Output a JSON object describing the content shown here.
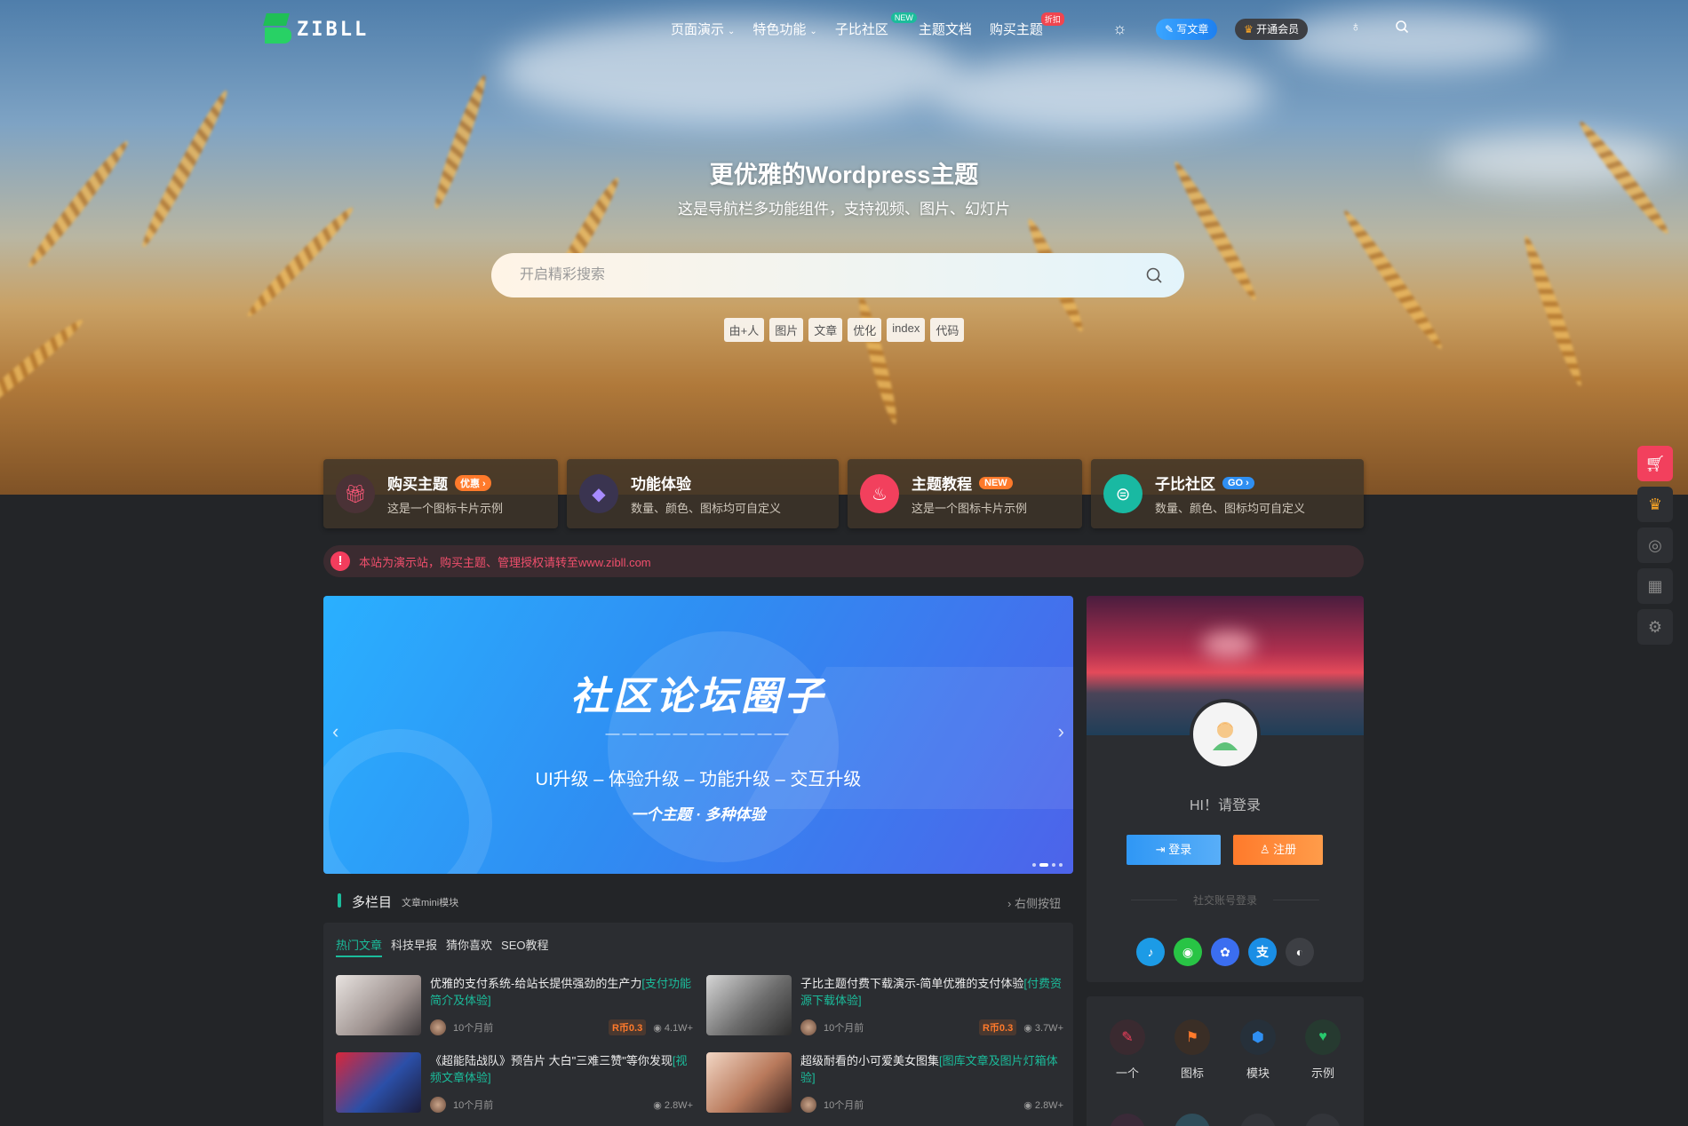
{
  "nav": {
    "logo_text": "ZIBLL",
    "menu": [
      {
        "label": "页面演示",
        "dropdown": true
      },
      {
        "label": "特色功能",
        "dropdown": true
      },
      {
        "label": "子比社区",
        "badge": "NEW"
      },
      {
        "label": "主题文档"
      },
      {
        "label": "购买主题",
        "badge": "折扣"
      }
    ],
    "write_label": "写文章",
    "vip_label": "开通会员"
  },
  "hero": {
    "title": "更优雅的Wordpress主题",
    "subtitle": "这是导航栏多功能组件，支持视频、图片、幻灯片",
    "search_placeholder": "开启精彩搜索",
    "tags": [
      "由+人",
      "图片",
      "文章",
      "优化",
      "index",
      "代码"
    ]
  },
  "cards": [
    {
      "title": "购买主题",
      "pill": "优惠 ›",
      "desc": "这是一个图标卡片示例",
      "color": "#e94560",
      "pill_color": "#ff7a2b"
    },
    {
      "title": "功能体验",
      "pill": "",
      "desc": "数量、颜色、图标均可自定义",
      "color": "#7b5cf0",
      "pill_color": ""
    },
    {
      "title": "主题教程",
      "pill": "NEW",
      "desc": "这是一个图标卡片示例",
      "color": "#f2405d",
      "pill_color": "#ff7a2b"
    },
    {
      "title": "子比社区",
      "pill": "GO ›",
      "desc": "数量、颜色、图标均可自定义",
      "color": "#19b9a2",
      "pill_color": "#2f8ff2"
    }
  ],
  "notice": "本站为演示站，购买主题、管理授权请转至www.zibll.com",
  "slider": {
    "title": "社区论坛圈子",
    "dashes": "———————————",
    "subtitle": "UI升级 – 体验升级 – 功能升级 – 交互升级",
    "tagline": "一个主题 · 多种体验"
  },
  "section": {
    "title": "多栏目",
    "subtitle": "文章mini模块",
    "right": "› 右侧按钮"
  },
  "tabs": [
    "热门文章",
    "科技早报",
    "猜你喜欢",
    "SEO教程"
  ],
  "articles": [
    {
      "title": "优雅的支付系统-给站长提供强劲的生产力",
      "tag": "[支付功能简介及体验]",
      "time": "10个月前",
      "price": "R币0.3",
      "views": "4.1W+"
    },
    {
      "title": "子比主题付费下载演示-简单优雅的支付体验",
      "tag": "[付费资源下载体验]",
      "time": "10个月前",
      "price": "R币0.3",
      "views": "3.7W+"
    },
    {
      "title": "《超能陆战队》预告片 大白\"三难三赞\"等你发现",
      "tag": "[视频文章体验]",
      "time": "10个月前",
      "price": "",
      "views": "2.8W+"
    },
    {
      "title": "超级耐看的小可爱美女图集",
      "tag": "[图库文章及图片灯箱体验]",
      "time": "10个月前",
      "price": "",
      "views": "2.8W+"
    }
  ],
  "user": {
    "greeting": "HI！请登录",
    "login": "登录",
    "register": "注册",
    "social_label": "社交账号登录"
  },
  "icon_grid": [
    {
      "label": "一个",
      "bg": "#3a2a30",
      "fg": "#f2405d"
    },
    {
      "label": "图标",
      "bg": "#3a2e26",
      "fg": "#ff7a2b"
    },
    {
      "label": "模块",
      "bg": "#26303a",
      "fg": "#2f8ff2"
    },
    {
      "label": "示例",
      "bg": "#263a30",
      "fg": "#28c86d"
    }
  ]
}
